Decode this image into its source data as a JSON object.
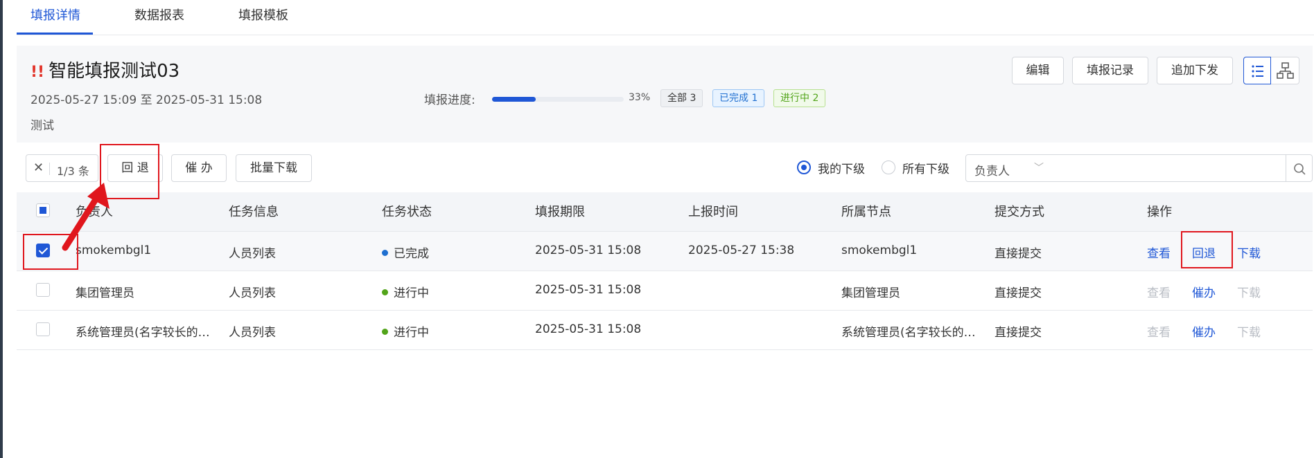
{
  "tabs": [
    {
      "label": "填报详情",
      "active": true
    },
    {
      "label": "数据报表",
      "active": false
    },
    {
      "label": "填报模板",
      "active": false
    }
  ],
  "header": {
    "warn_mark": "!!",
    "title": "智能填报测试03",
    "date_range": "2025-05-27 15:09 至 2025-05-31 15:08",
    "description": "测试",
    "progress_label": "填报进度:",
    "progress_percent": "33%",
    "progress_value": 0.33,
    "badges": {
      "all": "全部 3",
      "done": "已完成 1",
      "doing": "进行中 2"
    },
    "buttons": {
      "edit": "编辑",
      "records": "填报记录",
      "append": "追加下发"
    }
  },
  "toolbar": {
    "selected_count": "1/3 条",
    "rollback": "回 退",
    "urge": "催 办",
    "batch_download": "批量下载",
    "radio_mine": "我的下级",
    "radio_all": "所有下级",
    "filter_field": "负责人",
    "search_placeholder": ""
  },
  "table": {
    "headers": [
      "负责人",
      "任务信息",
      "任务状态",
      "填报期限",
      "上报时间",
      "所属节点",
      "提交方式",
      "操作"
    ],
    "rows": [
      {
        "owner": "smokembgl1",
        "task": "人员列表",
        "status": "已完成",
        "status_color": "#1f6fd0",
        "deadline": "2025-05-31 15:08",
        "reported": "2025-05-27 15:38",
        "node": "smokembgl1",
        "submit": "直接提交",
        "selected": true,
        "ops": {
          "view": "查看",
          "second": "回退",
          "download": "下载"
        }
      },
      {
        "owner": "集团管理员",
        "task": "人员列表",
        "status": "进行中",
        "status_color": "#52a41a",
        "deadline": "2025-05-31 15:08",
        "reported": "",
        "node": "集团管理员",
        "submit": "直接提交",
        "selected": false,
        "ops": {
          "view": "查看",
          "second": "催办",
          "download": "下载"
        }
      },
      {
        "owner": "系统管理员(名字较长的…",
        "task": "人员列表",
        "status": "进行中",
        "status_color": "#52a41a",
        "deadline": "2025-05-31 15:08",
        "reported": "",
        "node": "系统管理员(名字较长的…",
        "submit": "直接提交",
        "selected": false,
        "ops": {
          "view": "查看",
          "second": "催办",
          "download": "下载"
        }
      }
    ]
  },
  "colors": {
    "accent": "#1f57d6",
    "annotation": "#e0161d"
  }
}
